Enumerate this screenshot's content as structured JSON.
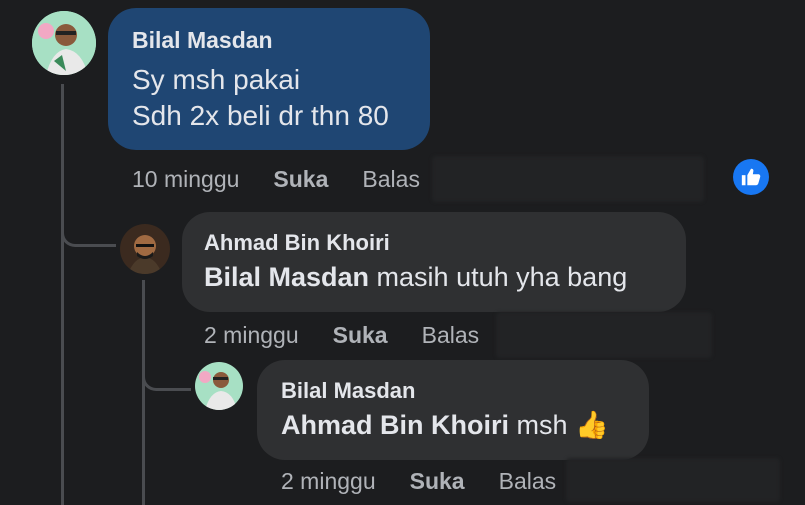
{
  "comments": [
    {
      "author": "Bilal Masdan",
      "lines": [
        "Sy msh pakai",
        "Sdh 2x beli dr thn 80"
      ],
      "time": "10 minggu",
      "like_label": "Suka",
      "reply_label": "Balas",
      "reaction_icon": "like-icon"
    },
    {
      "author": "Ahmad Bin Khoiri",
      "mention": "Bilal Masdan",
      "text": " masih utuh yha bang",
      "time": "2 minggu",
      "like_label": "Suka",
      "reply_label": "Balas"
    },
    {
      "author": "Bilal Masdan",
      "mention": "Ahmad Bin Khoiri",
      "text": " msh ",
      "emoji": "👍",
      "time": "2 minggu",
      "like_label": "Suka",
      "reply_label": "Balas"
    }
  ],
  "colors": {
    "background": "#1c1d1f",
    "bubble_highlight": "#1f4673",
    "bubble": "#2f3032",
    "secondary_text": "#b0b3b8",
    "like_blue": "#1877f2"
  }
}
